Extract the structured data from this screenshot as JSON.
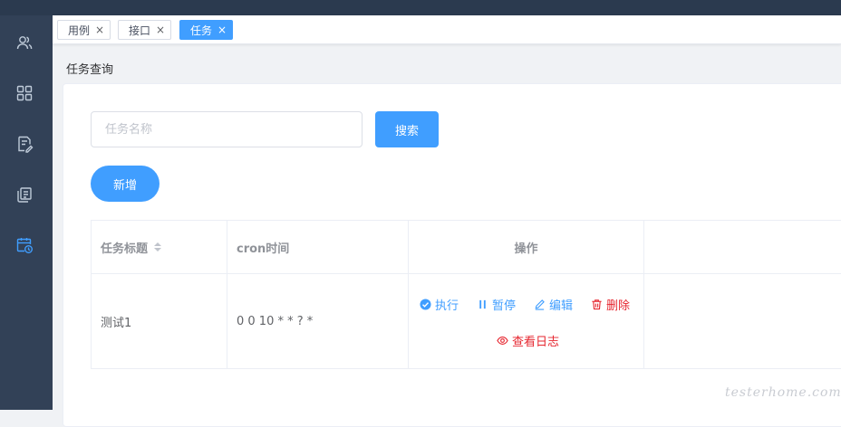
{
  "tabs": [
    {
      "label": "用例",
      "close": "×",
      "active": false
    },
    {
      "label": "接口",
      "close": "×",
      "active": false
    },
    {
      "label": "任务",
      "close": "×",
      "active": true
    }
  ],
  "sidebar": {
    "items": [
      {
        "icon": "users-icon"
      },
      {
        "icon": "grid-icon"
      },
      {
        "icon": "document-edit-icon"
      },
      {
        "icon": "report-icon"
      },
      {
        "icon": "calendar-clock-icon",
        "active": true
      }
    ]
  },
  "page": {
    "title": "任务查询"
  },
  "search": {
    "placeholder": "任务名称",
    "value": "",
    "button_label": "搜索"
  },
  "toolbar": {
    "add_label": "新增"
  },
  "table": {
    "headers": [
      "任务标题",
      "cron时间",
      "操作"
    ],
    "rows": [
      {
        "title": "测试1",
        "cron": "0 0 10 * * ? *"
      }
    ],
    "actions": {
      "execute": "执行",
      "pause": "暂停",
      "edit": "编辑",
      "delete": "删除",
      "view_log": "查看日志"
    }
  },
  "watermark": "testerhome.com",
  "colors": {
    "primary": "#409eff",
    "danger": "#e6262f",
    "sidebar": "#324157"
  }
}
